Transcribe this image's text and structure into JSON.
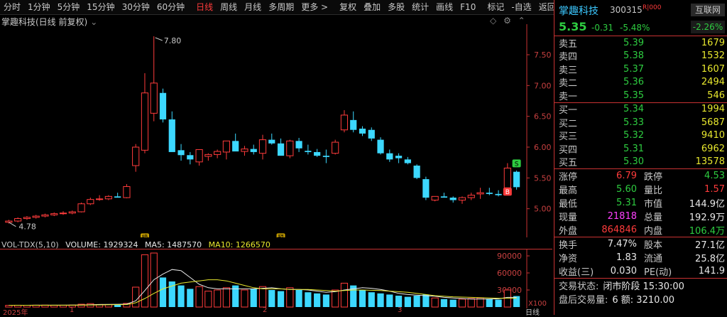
{
  "toolbar": {
    "items": [
      "分时",
      "1分钟",
      "5分钟",
      "15分钟",
      "30分钟",
      "60分钟",
      "日线",
      "周线",
      "月线",
      "多周期",
      "更多 >",
      "复权",
      "叠加",
      "多股",
      "统计",
      "画线",
      "F10",
      "标记",
      "-自选",
      "返回"
    ],
    "active_index": 6
  },
  "chart": {
    "title": "掌趣科技(日线 前复权)",
    "high_label": "7.80",
    "low_label": "4.78",
    "marker_bang": "榜",
    "marker_yu": "预",
    "marker_s": "S",
    "marker_b": "B",
    "y_ticks": [
      "7.50",
      "7.00",
      "6.50",
      "6.00",
      "5.50",
      "5.00"
    ]
  },
  "volume": {
    "label": "VOL-TDX(5,10)",
    "volume_text": "VOLUME: 1929324",
    "ma5_text": "MA5: 1487570",
    "ma10_text": "MA10: 1266570",
    "y_ticks": [
      "90000",
      "60000",
      "30000"
    ],
    "unit_label": "X100"
  },
  "xaxis": {
    "labels": [
      "2025年",
      "1",
      "2",
      "3"
    ],
    "right_label": "日线"
  },
  "quote": {
    "name": "掌趣科技",
    "code": "300315",
    "badge": "R|000",
    "tag": "互联网",
    "price": "5.35",
    "change": "-0.31",
    "change_pct": "-5.48%",
    "sector_pct": "-2.26%",
    "asks": [
      {
        "label": "卖五",
        "price": "5.39",
        "vol": "1679"
      },
      {
        "label": "卖四",
        "price": "5.38",
        "vol": "1532"
      },
      {
        "label": "卖三",
        "price": "5.37",
        "vol": "1607"
      },
      {
        "label": "卖二",
        "price": "5.36",
        "vol": "2494"
      },
      {
        "label": "卖一",
        "price": "5.35",
        "vol": "546"
      }
    ],
    "bids": [
      {
        "label": "买一",
        "price": "5.34",
        "vol": "1994"
      },
      {
        "label": "买二",
        "price": "5.33",
        "vol": "5687"
      },
      {
        "label": "买三",
        "price": "5.32",
        "vol": "9410"
      },
      {
        "label": "买四",
        "price": "5.31",
        "vol": "6962"
      },
      {
        "label": "买五",
        "price": "5.30",
        "vol": "13578"
      }
    ],
    "stats1": [
      {
        "k1": "涨停",
        "v1": "6.79",
        "c1": "red",
        "k2": "跌停",
        "v2": "4.53",
        "c2": "green"
      },
      {
        "k1": "最高",
        "v1": "5.60",
        "c1": "green",
        "k2": "量比",
        "v2": "1.57",
        "c2": "red"
      },
      {
        "k1": "最低",
        "v1": "5.31",
        "c1": "green",
        "k2": "市值",
        "v2": "144.9亿",
        "c2": "white"
      },
      {
        "k1": "现量",
        "v1": "21818",
        "c1": "magenta",
        "k2": "总量",
        "v2": "192.9万",
        "c2": "white"
      },
      {
        "k1": "外盘",
        "v1": "864846",
        "c1": "red",
        "k2": "内盘",
        "v2": "106.4万",
        "c2": "green"
      }
    ],
    "stats2": [
      {
        "k1": "换手",
        "v1": "7.47%",
        "c1": "white",
        "k2": "股本",
        "v2": "27.1亿",
        "c2": "white"
      },
      {
        "k1": "净资",
        "v1": "1.83",
        "c1": "white",
        "k2": "流通",
        "v2": "25.8亿",
        "c2": "white"
      },
      {
        "k1": "收益(三)",
        "v1": "0.030",
        "c1": "white",
        "k2": "PE(动)",
        "v2": "141.9",
        "c2": "white"
      }
    ],
    "trade_status_label": "交易状态:",
    "trade_status_value": "闭市阶段 15:30:00",
    "after_hours_label": "盘后交易量:",
    "after_hours_value": "6 额: 3210.00"
  },
  "chart_data": {
    "type": "candlestick",
    "y_range": [
      4.65,
      7.95
    ],
    "volume_range": [
      0,
      100000
    ],
    "candles": [
      [
        4.78,
        4.82,
        4.76,
        4.8
      ],
      [
        4.8,
        4.86,
        4.78,
        4.84
      ],
      [
        4.84,
        4.88,
        4.82,
        4.86
      ],
      [
        4.86,
        4.9,
        4.84,
        4.88
      ],
      [
        4.88,
        4.92,
        4.86,
        4.9
      ],
      [
        4.9,
        4.94,
        4.88,
        4.92
      ],
      [
        4.92,
        4.96,
        4.9,
        4.93
      ],
      [
        4.93,
        4.97,
        4.91,
        4.95
      ],
      [
        4.95,
        5.1,
        4.94,
        5.08
      ],
      [
        5.08,
        5.18,
        5.06,
        5.15
      ],
      [
        5.15,
        5.22,
        5.13,
        5.16
      ],
      [
        5.16,
        5.22,
        5.14,
        5.2
      ],
      [
        5.2,
        5.26,
        5.18,
        5.18
      ],
      [
        5.18,
        5.4,
        5.17,
        5.36
      ],
      [
        5.7,
        6.05,
        5.6,
        6.0
      ],
      [
        5.95,
        7.2,
        5.9,
        6.88
      ],
      [
        6.55,
        7.8,
        6.42,
        7.04
      ],
      [
        6.88,
        6.95,
        6.4,
        6.45
      ],
      [
        6.45,
        6.58,
        5.95,
        5.92
      ],
      [
        5.95,
        6.05,
        5.78,
        5.87
      ],
      [
        5.87,
        5.92,
        5.72,
        5.8
      ],
      [
        5.76,
        5.94,
        5.7,
        5.96
      ],
      [
        5.85,
        5.9,
        5.78,
        5.88
      ],
      [
        5.88,
        5.96,
        5.82,
        5.93
      ],
      [
        5.92,
        6.05,
        5.8,
        6.1
      ],
      [
        6.1,
        6.22,
        6.0,
        5.93
      ],
      [
        5.93,
        6.02,
        5.86,
        5.97
      ],
      [
        5.97,
        6.04,
        5.88,
        5.92
      ],
      [
        5.9,
        6.2,
        5.8,
        6.12
      ],
      [
        6.12,
        6.22,
        6.04,
        6.06
      ],
      [
        6.06,
        6.14,
        5.92,
        5.86
      ],
      [
        5.86,
        6.12,
        5.82,
        6.1
      ],
      [
        6.1,
        6.15,
        5.92,
        5.98
      ],
      [
        5.94,
        6.04,
        5.88,
        5.92
      ],
      [
        5.92,
        5.97,
        5.84,
        5.86
      ],
      [
        5.86,
        5.96,
        5.74,
        5.84
      ],
      [
        5.9,
        6.12,
        5.88,
        6.08
      ],
      [
        6.28,
        6.6,
        6.24,
        6.52
      ],
      [
        6.44,
        6.58,
        6.24,
        6.28
      ],
      [
        6.3,
        6.34,
        6.18,
        6.22
      ],
      [
        6.28,
        6.32,
        6.1,
        6.14
      ],
      [
        6.12,
        6.16,
        5.88,
        5.9
      ],
      [
        5.9,
        5.96,
        5.76,
        5.8
      ],
      [
        5.86,
        5.9,
        5.74,
        5.82
      ],
      [
        5.8,
        5.84,
        5.72,
        5.74
      ],
      [
        5.7,
        5.72,
        5.48,
        5.5
      ],
      [
        5.48,
        5.52,
        5.14,
        5.18
      ],
      [
        5.14,
        5.2,
        5.12,
        5.2
      ],
      [
        5.2,
        5.26,
        5.18,
        5.18
      ],
      [
        5.18,
        5.2,
        5.1,
        5.14
      ],
      [
        5.14,
        5.2,
        5.08,
        5.18
      ],
      [
        5.18,
        5.26,
        5.14,
        5.22
      ],
      [
        5.24,
        5.34,
        5.16,
        5.26
      ],
      [
        5.26,
        5.34,
        5.22,
        5.24
      ],
      [
        5.24,
        5.3,
        5.2,
        5.22
      ],
      [
        5.34,
        5.74,
        5.33,
        5.66
      ],
      [
        5.6,
        5.62,
        5.31,
        5.35
      ]
    ],
    "volumes": [
      3000,
      3200,
      3100,
      3300,
      3400,
      3000,
      3200,
      3500,
      5000,
      6000,
      4500,
      4200,
      4800,
      6500,
      35000,
      92000,
      95000,
      52000,
      45000,
      38000,
      32000,
      36000,
      28000,
      30000,
      34000,
      38000,
      30000,
      32000,
      36000,
      30000,
      28000,
      34000,
      30000,
      26000,
      24000,
      22000,
      30000,
      42000,
      38000,
      30000,
      26000,
      24000,
      22000,
      20000,
      18000,
      20000,
      22000,
      16000,
      14000,
      13000,
      14000,
      15000,
      16000,
      14000,
      13000,
      30000,
      19293
    ],
    "ma5": [
      3100,
      3150,
      3200,
      3250,
      3250,
      3300,
      3350,
      3400,
      3600,
      4000,
      4500,
      4700,
      4800,
      5200,
      11000,
      29000,
      48000,
      58000,
      66000,
      64000,
      52000,
      40000,
      34000,
      32000,
      32000,
      32000,
      32000,
      32000,
      33000,
      34000,
      32000,
      31000,
      31000,
      30000,
      28000,
      26000,
      27000,
      30000,
      32000,
      34000,
      33000,
      31000,
      28000,
      24000,
      22000,
      21000,
      20000,
      19000,
      17000,
      16000,
      15000,
      14000,
      14000,
      14000,
      14500,
      17000,
      17000
    ],
    "ma10": [
      3100,
      3120,
      3150,
      3180,
      3200,
      3220,
      3250,
      3280,
      3400,
      3600,
      3800,
      4000,
      4200,
      4400,
      7500,
      15000,
      24000,
      32000,
      37000,
      42000,
      44000,
      46000,
      48000,
      48000,
      46000,
      42000,
      38000,
      34000,
      32000,
      32000,
      32000,
      31000,
      31000,
      31000,
      30000,
      29000,
      28000,
      29000,
      30000,
      30000,
      29500,
      29000,
      28000,
      27000,
      26000,
      24000,
      22000,
      20000,
      19000,
      18000,
      17500,
      17000,
      16500,
      16000,
      15500,
      15500,
      15500
    ]
  }
}
